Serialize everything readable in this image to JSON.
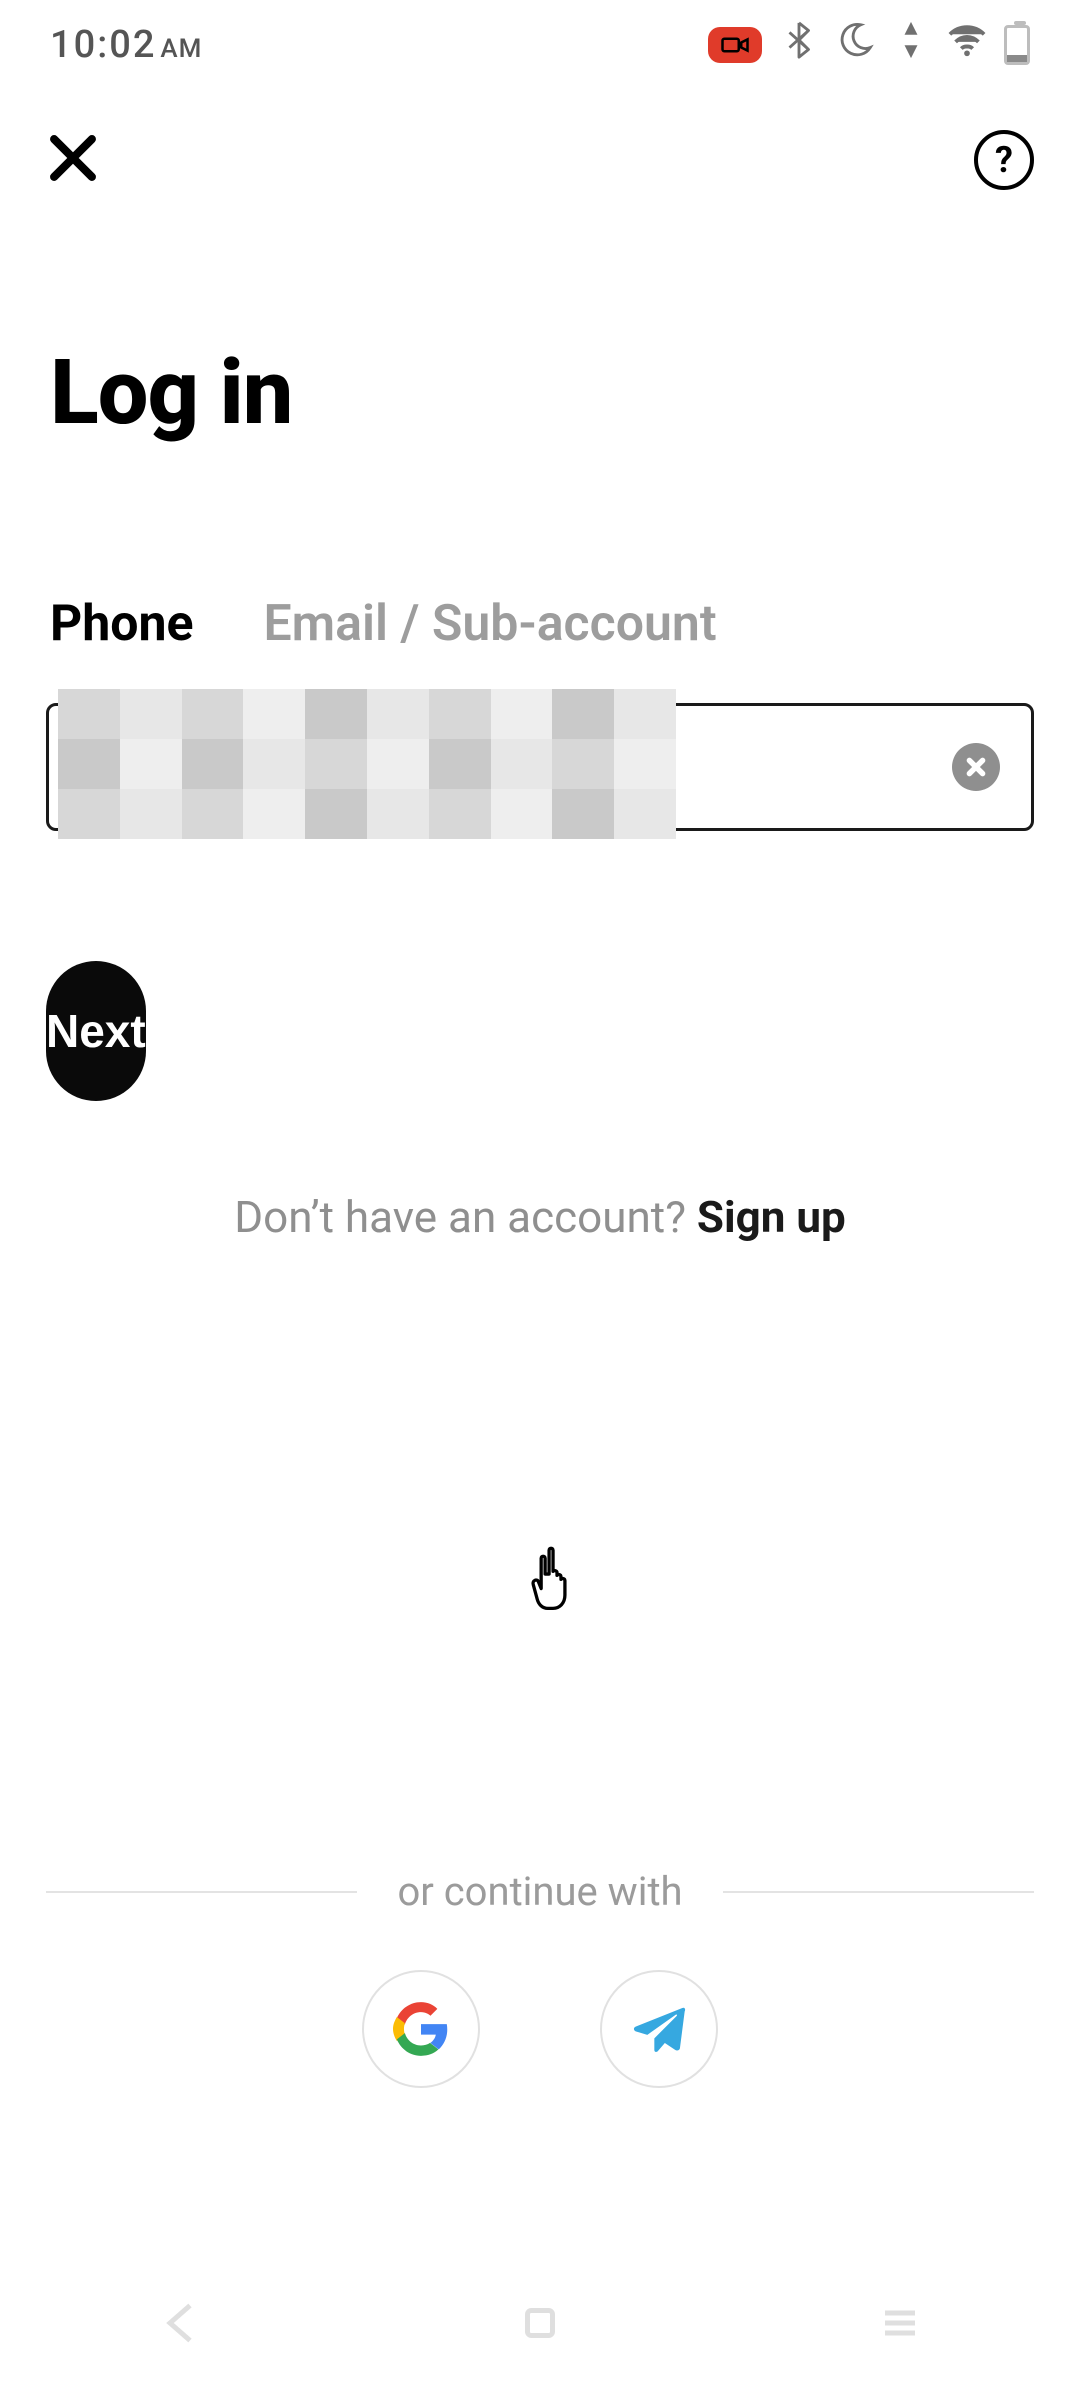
{
  "status_bar": {
    "time": "10:02",
    "ampm": "AM"
  },
  "header": {
    "title": "Log in"
  },
  "tabs": {
    "phone": "Phone",
    "email": "Email / Sub-account"
  },
  "input": {
    "value": "",
    "placeholder": ""
  },
  "buttons": {
    "next": "Next"
  },
  "signup": {
    "prompt": "Don’t have an account? ",
    "link": "Sign up"
  },
  "separator": {
    "label": "or continue with"
  },
  "help_glyph": "?"
}
